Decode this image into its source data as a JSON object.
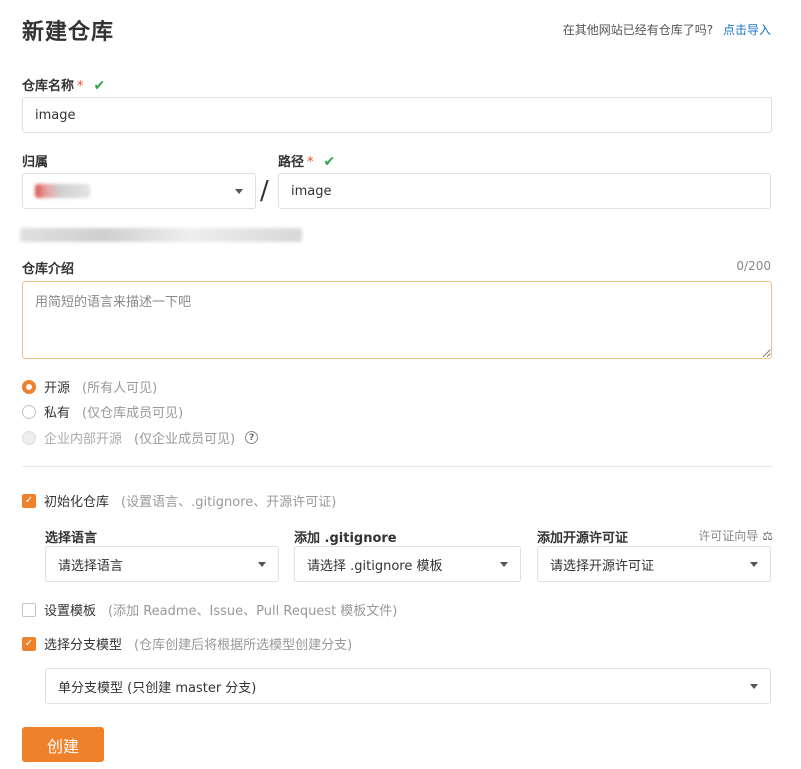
{
  "header": {
    "title": "新建仓库",
    "import_prompt": "在其他网站已经有仓库了吗?",
    "import_link": "点击导入"
  },
  "repo_name": {
    "label": "仓库名称",
    "required_mark": "*",
    "value": "image"
  },
  "owner": {
    "label": "归属"
  },
  "path": {
    "label": "路径",
    "required_mark": "*",
    "separator": "/",
    "value": "image"
  },
  "description": {
    "label": "仓库介绍",
    "counter": "0/200",
    "placeholder": "用简短的语言来描述一下吧"
  },
  "visibility": {
    "options": [
      {
        "label": "开源",
        "hint": "(所有人可见)",
        "selected": true,
        "disabled": false
      },
      {
        "label": "私有",
        "hint": "(仅仓库成员可见)",
        "selected": false,
        "disabled": false
      },
      {
        "label": "企业内部开源",
        "hint": "(仅企业成员可见)",
        "selected": false,
        "disabled": true
      }
    ],
    "help_icon": "?"
  },
  "init_repo": {
    "label": "初始化仓库",
    "hint": "(设置语言、.gitignore、开源许可证)",
    "checked": true,
    "language": {
      "label": "选择语言",
      "placeholder": "请选择语言"
    },
    "gitignore": {
      "label": "添加 .gitignore",
      "placeholder": "请选择 .gitignore 模板"
    },
    "license": {
      "label": "添加开源许可证",
      "placeholder": "请选择开源许可证",
      "guide": "许可证向导"
    }
  },
  "template": {
    "label": "设置模板",
    "hint": "(添加 Readme、Issue、Pull Request 模板文件)",
    "checked": false
  },
  "branch_model": {
    "label": "选择分支模型",
    "hint": "(仓库创建后将根据所选模型创建分支)",
    "checked": true,
    "selected": "单分支模型 (只创建 master 分支)"
  },
  "submit": {
    "label": "创建"
  },
  "colors": {
    "accent": "#f0812b",
    "link": "#1a73c8",
    "valid": "#2ea44f",
    "required": "#e84e2c"
  }
}
